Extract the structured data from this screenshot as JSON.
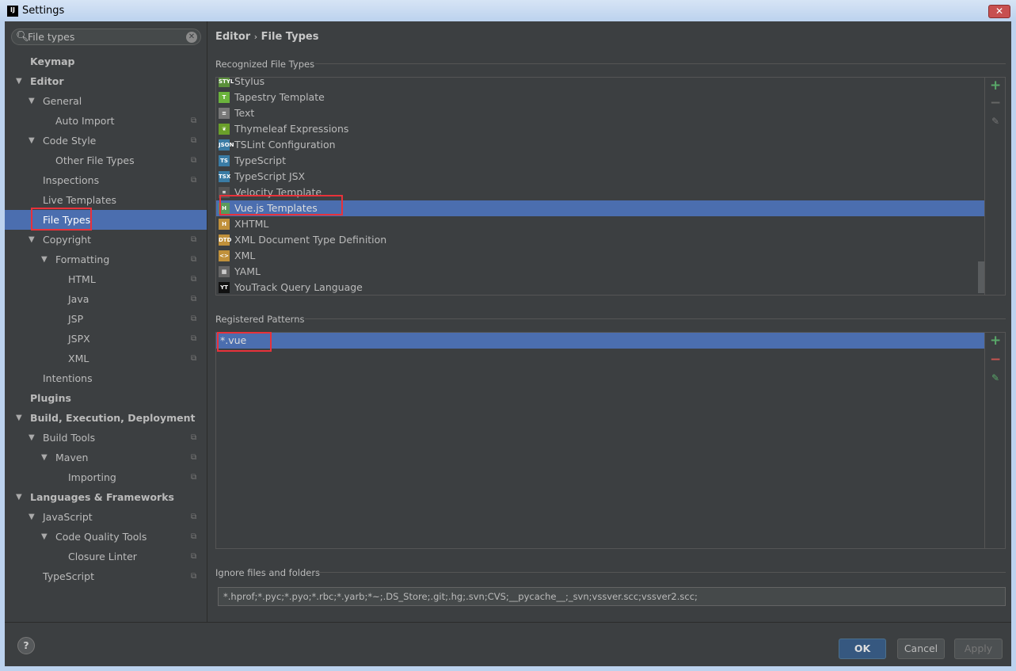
{
  "window": {
    "title": "Settings",
    "logo": "IJ",
    "close": "✕"
  },
  "search": {
    "value": "File types"
  },
  "tree": [
    {
      "label": "Keymap",
      "level": 0,
      "bold": true,
      "arrow": false,
      "copy": false
    },
    {
      "label": "Editor",
      "level": 0,
      "bold": true,
      "arrow": true,
      "copy": false
    },
    {
      "label": "General",
      "level": 1,
      "arrow": true,
      "copy": false
    },
    {
      "label": "Auto Import",
      "level": 2,
      "copy": true
    },
    {
      "label": "Code Style",
      "level": 1,
      "arrow": true,
      "copy": true
    },
    {
      "label": "Other File Types",
      "level": 2,
      "copy": true
    },
    {
      "label": "Inspections",
      "level": 1,
      "copy": true
    },
    {
      "label": "Live Templates",
      "level": 1,
      "copy": false
    },
    {
      "label": "File Types",
      "level": 1,
      "copy": false,
      "selected": true
    },
    {
      "label": "Copyright",
      "level": 1,
      "arrow": true,
      "copy": true
    },
    {
      "label": "Formatting",
      "level": 2,
      "arrow": true,
      "copy": true
    },
    {
      "label": "HTML",
      "level": 3,
      "copy": true
    },
    {
      "label": "Java",
      "level": 3,
      "copy": true
    },
    {
      "label": "JSP",
      "level": 3,
      "copy": true
    },
    {
      "label": "JSPX",
      "level": 3,
      "copy": true
    },
    {
      "label": "XML",
      "level": 3,
      "copy": true
    },
    {
      "label": "Intentions",
      "level": 1,
      "copy": false
    },
    {
      "label": "Plugins",
      "level": 0,
      "bold": true,
      "copy": false
    },
    {
      "label": "Build, Execution, Deployment",
      "level": 0,
      "bold": true,
      "arrow": true,
      "copy": false
    },
    {
      "label": "Build Tools",
      "level": 1,
      "arrow": true,
      "copy": true
    },
    {
      "label": "Maven",
      "level": 2,
      "arrow": true,
      "copy": true
    },
    {
      "label": "Importing",
      "level": 3,
      "copy": true
    },
    {
      "label": "Languages & Frameworks",
      "level": 0,
      "bold": true,
      "arrow": true,
      "copy": false
    },
    {
      "label": "JavaScript",
      "level": 1,
      "arrow": true,
      "copy": true
    },
    {
      "label": "Code Quality Tools",
      "level": 2,
      "arrow": true,
      "copy": true
    },
    {
      "label": "Closure Linter",
      "level": 3,
      "copy": true
    },
    {
      "label": "TypeScript",
      "level": 1,
      "copy": true
    }
  ],
  "main": {
    "breadcrumb": {
      "parent": "Editor",
      "sep": "›",
      "current": "File Types"
    },
    "recognized_label": "Recognized File Types",
    "file_types": [
      {
        "label": "Stylus",
        "icon": "STYL",
        "color": "#5a8f3a"
      },
      {
        "label": "Tapestry Template",
        "icon": "T",
        "color": "#6bb33c"
      },
      {
        "label": "Text",
        "icon": "≡",
        "color": "#777"
      },
      {
        "label": "Thymeleaf Expressions",
        "icon": "❦",
        "color": "#6a9f2a"
      },
      {
        "label": "TSLint Configuration",
        "icon": "JSON",
        "color": "#3a7ca5"
      },
      {
        "label": "TypeScript",
        "icon": "TS",
        "color": "#3a7ca5"
      },
      {
        "label": "TypeScript JSX",
        "icon": "TSX",
        "color": "#3a7ca5"
      },
      {
        "label": "Velocity Template",
        "icon": "⌗",
        "color": "#555"
      },
      {
        "label": "Vue.js Templates",
        "icon": "H",
        "color": "#5a9a5a",
        "selected": true
      },
      {
        "label": "XHTML",
        "icon": "H",
        "color": "#c0903a"
      },
      {
        "label": "XML Document Type Definition",
        "icon": "DTD",
        "color": "#c0903a"
      },
      {
        "label": "XML",
        "icon": "<>",
        "color": "#c0903a"
      },
      {
        "label": "YAML",
        "icon": "▦",
        "color": "#666"
      },
      {
        "label": "YouTrack Query Language",
        "icon": "YT",
        "color": "#111"
      }
    ],
    "patterns_label": "Registered Patterns",
    "patterns": [
      "*.vue"
    ],
    "ignore_label": "Ignore files and folders",
    "ignore_value": "*.hprof;*.pyc;*.pyo;*.rbc;*.yarb;*~;.DS_Store;.git;.hg;.svn;CVS;__pycache__;_svn;vssver.scc;vssver2.scc;"
  },
  "buttons": {
    "help": "?",
    "ok": "OK",
    "cancel": "Cancel",
    "apply": "Apply"
  },
  "colors": {
    "selection": "#4b6eaf",
    "add": "#59a869",
    "remove": "#c75450",
    "highlight": "#e8323a"
  }
}
